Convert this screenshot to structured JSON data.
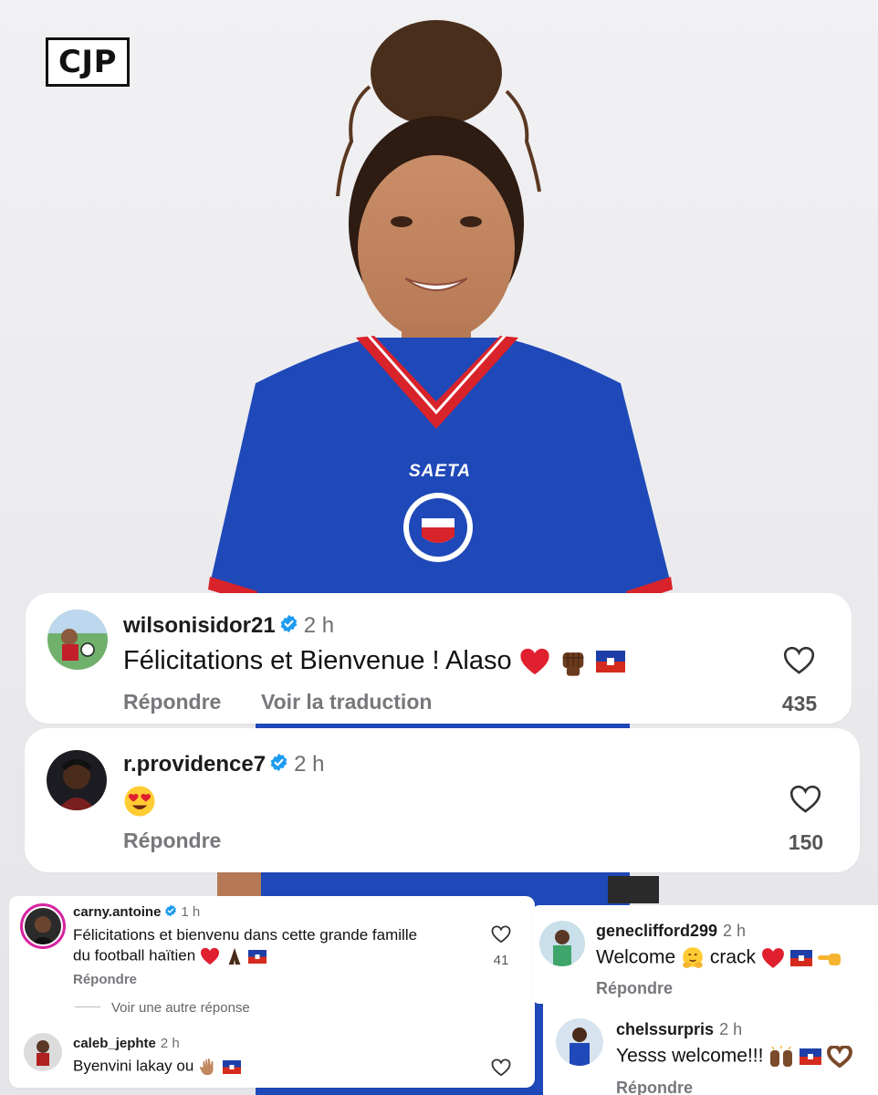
{
  "logo": {
    "text": "CJP"
  },
  "jersey": {
    "brand": "SAETA"
  },
  "comments": [
    {
      "username": "wilsonisidor21",
      "verified": true,
      "time": "2 h",
      "text": "Félicitations et Bienvenue ! Alaso",
      "emojis": [
        "red-heart",
        "raised-fist",
        "haiti-flag"
      ],
      "actions": [
        "Répondre",
        "Voir la traduction"
      ],
      "likes": "435"
    },
    {
      "username": "r.providence7",
      "verified": true,
      "time": "2 h",
      "text": "",
      "emojis": [
        "heart-eyes"
      ],
      "actions": [
        "Répondre"
      ],
      "likes": "150"
    },
    {
      "username": "carny.antoine",
      "verified": true,
      "time": "1 h",
      "text_line1": "Félicitations et bienvenu dans cette grande famille",
      "text_line2": "du football haïtien",
      "emojis": [
        "red-heart",
        "folded-hands",
        "haiti-flag"
      ],
      "actions": [
        "Répondre"
      ],
      "likes": "41",
      "more_replies": "Voir une autre réponse"
    },
    {
      "username": "caleb_jephte",
      "verified": false,
      "time": "2 h",
      "text": "Byenvini lakay ou",
      "emojis": [
        "waving-hand",
        "haiti-flag"
      ]
    },
    {
      "username": "geneclifford299",
      "verified": false,
      "time": "2 h",
      "text_a": "Welcome",
      "text_b": "crack",
      "emojis": [
        "hugging-face",
        "red-heart",
        "haiti-flag",
        "pointing-hand"
      ],
      "actions": [
        "Répondre"
      ]
    },
    {
      "username": "chelssurpris",
      "verified": false,
      "time": "2 h",
      "text": "Yesss welcome!!!",
      "emojis": [
        "raised-hands",
        "haiti-flag",
        "heart-hands"
      ],
      "actions": [
        "Répondre"
      ]
    }
  ],
  "colors": {
    "background": "#ececef",
    "jersey_blue": "#1f48b8",
    "jersey_red": "#d8232a",
    "verified_blue": "#1d9bf0",
    "heart_red": "#e0202e"
  }
}
